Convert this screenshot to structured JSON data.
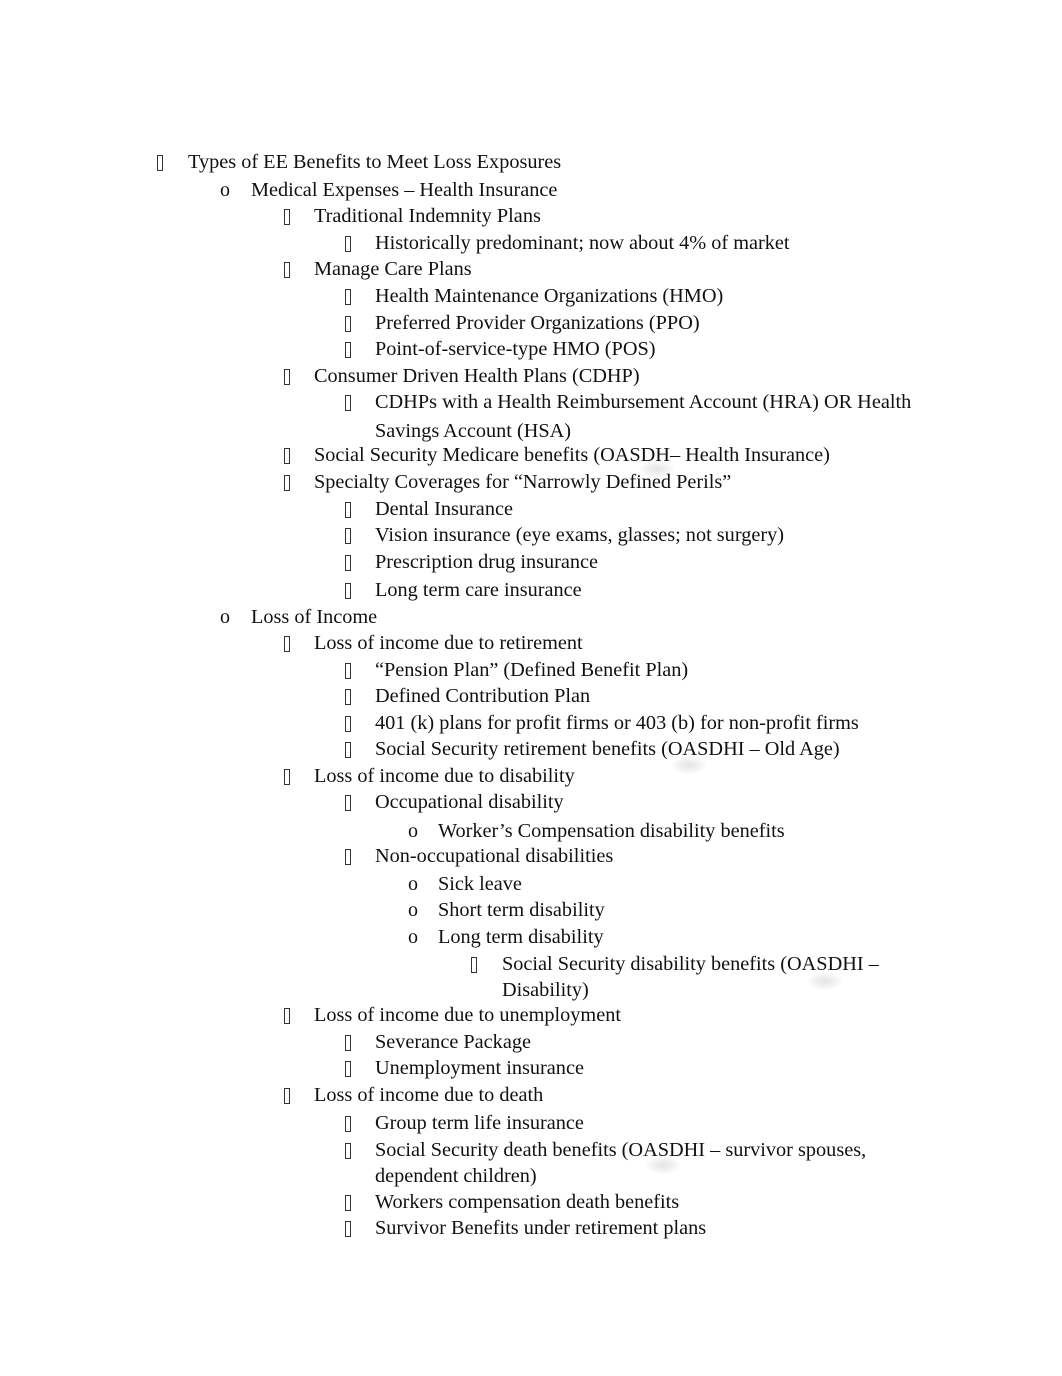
{
  "document": {
    "items": [
      {
        "level": 0,
        "bullet": "tofu",
        "text": "Types of EE Benefits to Meet Loss Exposures"
      },
      {
        "level": 1,
        "bullet": "o",
        "text": "Medical Expenses – Health Insurance"
      },
      {
        "level": 2,
        "bullet": "tofu",
        "text": "Traditional Indemnity Plans"
      },
      {
        "level": 3,
        "bullet": "tofu",
        "text": "Historically predominant; now about 4% of market"
      },
      {
        "level": 2,
        "bullet": "tofu",
        "text": "Manage Care Plans"
      },
      {
        "level": 3,
        "bullet": "tofu",
        "text": "Health Maintenance Organizations (HMO)"
      },
      {
        "level": 3,
        "bullet": "tofu",
        "text": "Preferred Provider Organizations (PPO)"
      },
      {
        "level": 3,
        "bullet": "tofu",
        "text": "Point-of-service-type HMO (POS)"
      },
      {
        "level": 2,
        "bullet": "tofu",
        "text": "Consumer Driven Health Plans (CDHP)"
      },
      {
        "level": 3,
        "bullet": "tofu",
        "text": "CDHPs with a Health Reimbursement Account (HRA) OR Health",
        "continuation": "Savings Account (HSA)"
      },
      {
        "level": 2,
        "bullet": "tofu",
        "text": "Social Security Medicare benefits (OASDH– Health Insurance)"
      },
      {
        "level": 2,
        "bullet": "tofu",
        "text": "Specialty Coverages for “Narrowly Defined Perils”"
      },
      {
        "level": 3,
        "bullet": "tofu",
        "text": "Dental Insurance"
      },
      {
        "level": 3,
        "bullet": "tofu",
        "text": "Vision insurance (eye exams, glasses; not surgery)"
      },
      {
        "level": 3,
        "bullet": "tofu",
        "text": "Prescription drug insurance"
      },
      {
        "level": 3,
        "bullet": "tofu",
        "text": "Long term care insurance"
      },
      {
        "level": 1,
        "bullet": "o",
        "text": "Loss of Income"
      },
      {
        "level": 2,
        "bullet": "tofu",
        "text": "Loss of income due to retirement"
      },
      {
        "level": 3,
        "bullet": "tofu",
        "text": "“Pension Plan” (Defined Benefit Plan)"
      },
      {
        "level": 3,
        "bullet": "tofu",
        "text": "Defined Contribution Plan"
      },
      {
        "level": 3,
        "bullet": "tofu",
        "text": "401 (k) plans for profit firms or 403 (b) for non-profit firms"
      },
      {
        "level": 3,
        "bullet": "tofu",
        "text": "Social Security retirement benefits (OASDHI – Old Age)"
      },
      {
        "level": 2,
        "bullet": "tofu",
        "text": "Loss of income due to disability"
      },
      {
        "level": 3,
        "bullet": "tofu",
        "text": "Occupational disability"
      },
      {
        "level": 4,
        "bullet": "o",
        "text": "Worker’s Compensation disability benefits"
      },
      {
        "level": 3,
        "bullet": "tofu",
        "text": "Non-occupational disabilities"
      },
      {
        "level": 4,
        "bullet": "o",
        "text": "Sick leave"
      },
      {
        "level": 4,
        "bullet": "o",
        "text": "Short term disability"
      },
      {
        "level": 4,
        "bullet": "o",
        "text": "Long term disability"
      },
      {
        "level": 5,
        "bullet": "tofu",
        "text": "Social Security disability benefits (OASDHI –",
        "continuation": "Disability)"
      },
      {
        "level": 2,
        "bullet": "tofu",
        "text": "Loss of income due to unemployment"
      },
      {
        "level": 3,
        "bullet": "tofu",
        "text": "Severance Package"
      },
      {
        "level": 3,
        "bullet": "tofu",
        "text": "Unemployment insurance"
      },
      {
        "level": 2,
        "bullet": "tofu",
        "text": "Loss of income due to death"
      },
      {
        "level": 3,
        "bullet": "tofu",
        "text": "Group term life insurance"
      },
      {
        "level": 3,
        "bullet": "tofu",
        "text": "Social Security death benefits (OASDHI – survivor spouses,",
        "continuation": "dependent children)"
      },
      {
        "level": 3,
        "bullet": "tofu",
        "text": "Workers compensation death benefits"
      },
      {
        "level": 3,
        "bullet": "tofu",
        "text": "Survivor Benefits under retirement plans"
      }
    ]
  }
}
